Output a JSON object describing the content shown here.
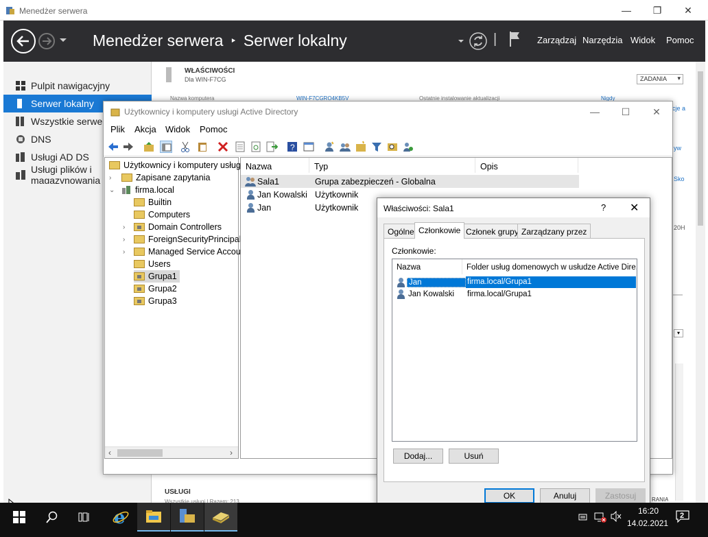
{
  "server_manager": {
    "window_title": "Menedżer serwera",
    "breadcrumb_root": "Menedżer serwera",
    "breadcrumb_separator": "‣",
    "breadcrumb_current": "Serwer lokalny",
    "header_separator": "|",
    "menu": [
      "Zarządzaj",
      "Narzędzia",
      "Widok",
      "Pomoc"
    ],
    "nav": [
      {
        "label": "Pulpit nawigacyjny",
        "icon": "dashboard-icon"
      },
      {
        "label": "Serwer lokalny",
        "icon": "server-icon",
        "selected": true
      },
      {
        "label": "Wszystkie serwery",
        "icon": "servers-icon"
      },
      {
        "label": "DNS",
        "icon": "dns-icon"
      },
      {
        "label": "Usługi AD DS",
        "icon": "adds-icon"
      },
      {
        "label": "Usługi plików i magazynowania",
        "icon": "files-icon"
      }
    ],
    "properties_title": "WŁAŚCIWOŚCI",
    "properties_subtitle": "Dla WIN-F7CG",
    "tasks_button": "ZADANIA",
    "computer_name_label": "Nazwa komputera",
    "computer_name_value": "WIN-F7CGRO4KB5V",
    "last_update_label": "Ostatnie instalowanie aktualizacji",
    "last_update_value": "Nigdy",
    "services_title": "USŁUGI",
    "services_subtitle": "Wszystkie usługi | Razem: 213",
    "right_fragments": [
      "cje a",
      "yw",
      "Sko",
      "20H",
      "RANIA"
    ]
  },
  "ad_window": {
    "title": "Użytkownicy i komputery usługi Active Directory",
    "menu": [
      "Plik",
      "Akcja",
      "Widok",
      "Pomoc"
    ],
    "tree": [
      {
        "label": "Użytkownicy i komputery usługi Active Directory",
        "level": 0,
        "expander": ""
      },
      {
        "label": "Zapisane zapytania",
        "level": 1,
        "expander": "›"
      },
      {
        "label": "firma.local",
        "level": 1,
        "expander": "⌄"
      },
      {
        "label": "Builtin",
        "level": 2,
        "expander": ""
      },
      {
        "label": "Computers",
        "level": 2,
        "expander": ""
      },
      {
        "label": "Domain Controllers",
        "level": 2,
        "expander": "›"
      },
      {
        "label": "ForeignSecurityPrincipals",
        "level": 2,
        "expander": "›"
      },
      {
        "label": "Managed Service Accounts",
        "level": 2,
        "expander": "›"
      },
      {
        "label": "Users",
        "level": 2,
        "expander": ""
      },
      {
        "label": "Grupa1",
        "level": 2,
        "expander": "",
        "selected": true
      },
      {
        "label": "Grupa2",
        "level": 2,
        "expander": ""
      },
      {
        "label": "Grupa3",
        "level": 2,
        "expander": ""
      }
    ],
    "columns": [
      "Nazwa",
      "Typ",
      "Opis"
    ],
    "rows": [
      {
        "name": "Sala1",
        "type": "Grupa zabezpieczeń - Globalna",
        "icon": "group-icon"
      },
      {
        "name": "Jan Kowalski",
        "type": "Użytkownik",
        "icon": "user-icon"
      },
      {
        "name": "Jan",
        "type": "Użytkownik",
        "icon": "user-icon"
      }
    ]
  },
  "dialog": {
    "title": "Właściwości: Sala1",
    "help": "?",
    "tabs": [
      "Ogólne",
      "Członkowie",
      "Członek grupy",
      "Zarządzany przez"
    ],
    "members_label": "Członkowie:",
    "columns": [
      "Nazwa",
      "Folder usług domenowych w usłudze Active Dire..."
    ],
    "members": [
      {
        "name": "Jan",
        "folder": "firma.local/Grupa1"
      },
      {
        "name": "Jan Kowalski",
        "folder": "firma.local/Grupa1"
      }
    ],
    "add_button": "Dodaj...",
    "remove_button": "Usuń",
    "ok_button": "OK",
    "cancel_button": "Anuluj",
    "apply_button": "Zastosuj"
  },
  "taskbar": {
    "time": "16:20",
    "date": "14.02.2021",
    "notifications": "2"
  },
  "colors": {
    "header_bg": "#2d2d30",
    "nav_selected": "#1a79d4",
    "selection": "#0078d7",
    "taskbar": "#101010"
  }
}
